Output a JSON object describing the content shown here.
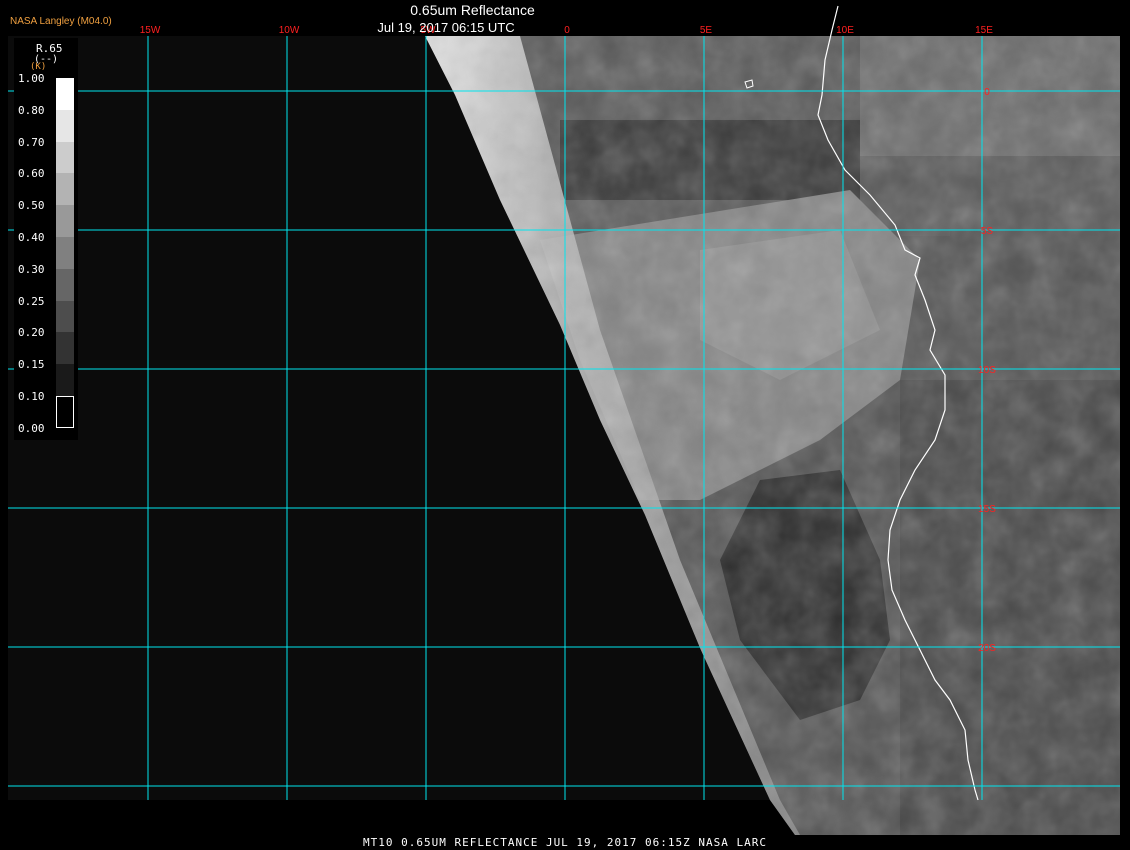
{
  "header": {
    "title": "0.65um Reflectance",
    "datetime": "Jul 19, 2017 06:15 UTC",
    "provider": "NASA Langley (M04.0)"
  },
  "footer": {
    "caption": "MT10  0.65UM REFLECTANCE   JUL 19, 2017 06:15Z   NASA LARC"
  },
  "legend": {
    "variable": "R.65",
    "unit": "(--)",
    "unit_alt": "(K)",
    "ticks": [
      "1.00",
      "0.80",
      "0.70",
      "0.60",
      "0.50",
      "0.40",
      "0.30",
      "0.25",
      "0.20",
      "0.15",
      "0.10",
      "0.00"
    ]
  },
  "grid": {
    "longitude_labels": [
      "15W",
      "10W",
      "5W",
      "0",
      "5E",
      "10E",
      "15E"
    ],
    "latitude_labels": [
      "0",
      "5S",
      "10S",
      "15S",
      "20S"
    ]
  },
  "colors": {
    "background": "#000000",
    "grid_line": "#00e5ee",
    "grid_label": "#ff2020",
    "coastline": "#ffffff",
    "provider_text": "#f0a040"
  }
}
